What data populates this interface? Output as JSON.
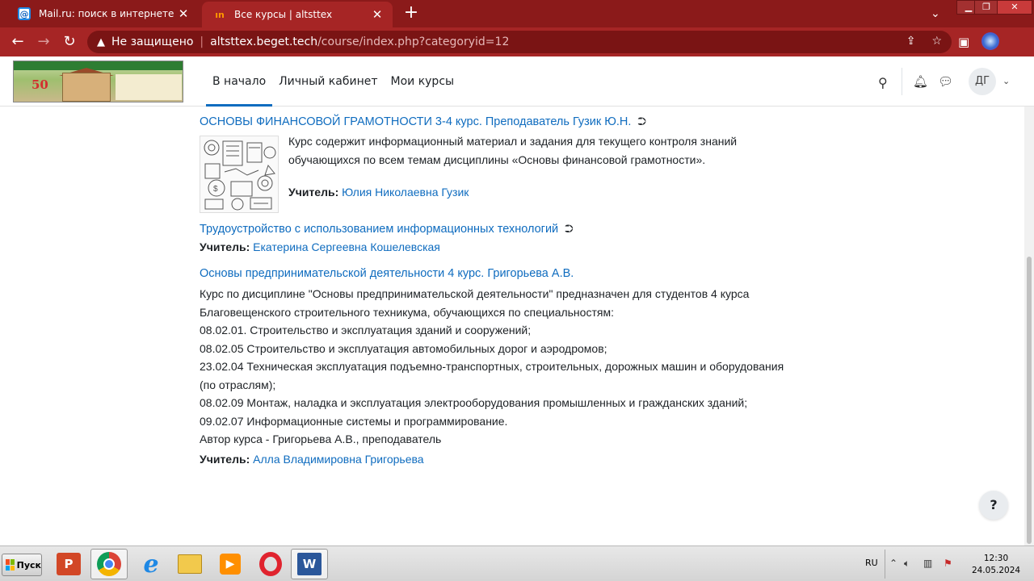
{
  "browser": {
    "tabs": [
      {
        "title": "Mail.ru: поиск в интернете",
        "favicon": "mailru-at-icon"
      },
      {
        "title": "Все курсы | altsttex",
        "favicon": "altsttex-icon",
        "active": true
      }
    ],
    "new_tab_label": "+",
    "address": {
      "security_label": "Не защищено",
      "host": "altsttex.beget.tech",
      "path": "/course/index.php?categoryid=12"
    }
  },
  "site": {
    "logo": {
      "number": "50"
    },
    "nav": {
      "home": "В начало",
      "dashboard": "Личный кабинет",
      "my_courses": "Мои курсы"
    },
    "user_initials": "ДГ"
  },
  "courses": [
    {
      "title": "ОСНОВЫ ФИНАНСОВОЙ ГРАМОТНОСТИ 3-4 курс. Преподаватель Гузик Ю.Н.",
      "enrol_icon": "sign-in-icon",
      "summary_lines": [
        "Курс содержит информационный материал и задания для текущего контроля знаний",
        "обучающихся по всем темам дисциплины  «Основы финансовой грамотности»."
      ],
      "teacher_label": "Учитель:",
      "teacher": "Юлия Николаевна Гузик"
    },
    {
      "title": "Трудоустройство с использованием информационных технологий",
      "enrol_icon": "sign-in-icon",
      "teacher_label": "Учитель:",
      "teacher": "Екатерина Сергеевна Кошелевская"
    },
    {
      "title": "Основы предпринимательской деятельности 4 курс. Григорьева А.В.",
      "summary_lines": [
        "Курс по дисциплине \"Основы предпринимательской деятельности\" предназначен для студентов 4 курса",
        "Благовещенского строительного техникума, обучающихся по специальностям:",
        "08.02.01. Строительство и эксплуатация зданий и сооружений;",
        "08.02.05 Строительство и эксплуатация автомобильных дорог и аэродромов;",
        "23.02.04 Техническая эксплуатация подъемно-транспортных, строительных, дорожных машин и оборудования",
        "(по отраслям);",
        "08.02.09 Монтаж, наладка и эксплуатация электрооборудования промышленных и гражданских зданий;",
        "09.02.07 Информационные системы и программирование.",
        "Автор курса - Григорьева А.В., преподаватель"
      ],
      "teacher_label": "Учитель:",
      "teacher": "Алла Владимировна Григорьева"
    }
  ],
  "help_label": "?",
  "taskbar": {
    "start_label": "Пуск",
    "apps": [
      "powerpoint-icon",
      "chrome-icon",
      "internet-explorer-icon",
      "file-manager-icon",
      "media-player-icon",
      "opera-icon",
      "word-icon"
    ],
    "language": "RU",
    "time": "12:30",
    "date": "24.05.2024"
  }
}
